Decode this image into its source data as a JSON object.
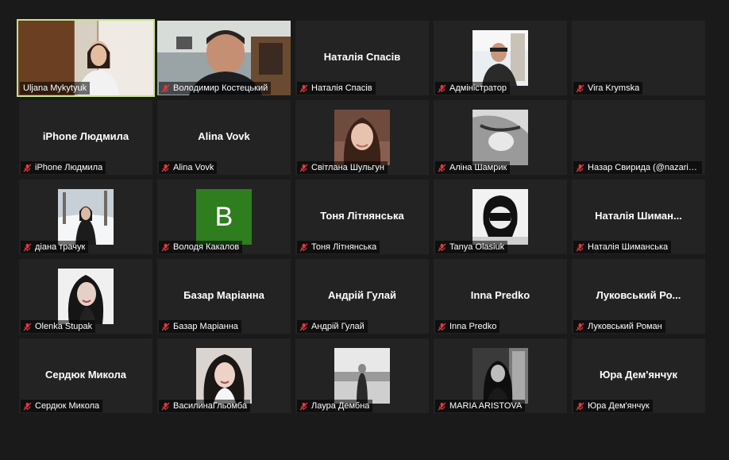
{
  "participants": [
    {
      "name": "Uljana Mykytyuk",
      "display": "video",
      "muted": false,
      "active": true
    },
    {
      "name": "Володимир Костецький",
      "display": "video",
      "muted": true,
      "active": false
    },
    {
      "name": "Наталія Спасів",
      "display": "name",
      "muted": true,
      "active": false
    },
    {
      "name": "Адміністратор",
      "display": "photo",
      "muted": true,
      "active": false
    },
    {
      "name": "Vira Krymska",
      "display": "blank",
      "muted": true,
      "active": false
    },
    {
      "name": "iPhone Людмила",
      "display": "name",
      "muted": true,
      "active": false
    },
    {
      "name": "Alina Vovk",
      "display": "name",
      "muted": true,
      "active": false
    },
    {
      "name": "Світлана Шульгун",
      "display": "photo",
      "muted": true,
      "active": false
    },
    {
      "name": "Аліна Шамрик",
      "display": "photo",
      "muted": true,
      "active": false
    },
    {
      "name": "Назар Свирида (@nazariu...",
      "display": "blank",
      "muted": true,
      "active": false
    },
    {
      "name": "діана трачук",
      "display": "photo",
      "muted": true,
      "active": false
    },
    {
      "name": "Володя Какалов",
      "display": "letter",
      "letter": "B",
      "muted": true,
      "active": false
    },
    {
      "name": "Тоня Літнянська",
      "display": "name",
      "muted": true,
      "active": false
    },
    {
      "name": "Tanya Olasiuk",
      "display": "photo",
      "muted": true,
      "active": false
    },
    {
      "name": "Наталія Шиманська",
      "title": "Наталія  Шиман...",
      "display": "name",
      "muted": true,
      "active": false
    },
    {
      "name": "Olenka Stupak",
      "display": "photo",
      "muted": true,
      "active": false
    },
    {
      "name": "Базар Маріанна",
      "display": "name",
      "muted": true,
      "active": false
    },
    {
      "name": "Андрій Гулай",
      "display": "name",
      "muted": true,
      "active": false
    },
    {
      "name": "Inna Predko",
      "display": "name",
      "muted": true,
      "active": false
    },
    {
      "name": "Луковський Роман",
      "title": "Луковський  Ро...",
      "display": "name",
      "muted": true,
      "active": false
    },
    {
      "name": "Сердюк Микола",
      "display": "name",
      "muted": true,
      "active": false
    },
    {
      "name": "ВасилинаГльомба",
      "display": "photo",
      "muted": true,
      "active": false
    },
    {
      "name": "Лаура Дембна",
      "display": "photo",
      "muted": true,
      "active": false
    },
    {
      "name": "MARIA ARISTOVA",
      "display": "photo",
      "muted": true,
      "active": false
    },
    {
      "name": "Юра Дем'янчук",
      "display": "name",
      "muted": true,
      "active": false
    }
  ],
  "colors": {
    "background": "#1a1a1a",
    "tile": "#232323",
    "active_border": "#c5e48a",
    "muted_icon": "#e0393e",
    "letter_avatar": "#2e7d1f"
  }
}
